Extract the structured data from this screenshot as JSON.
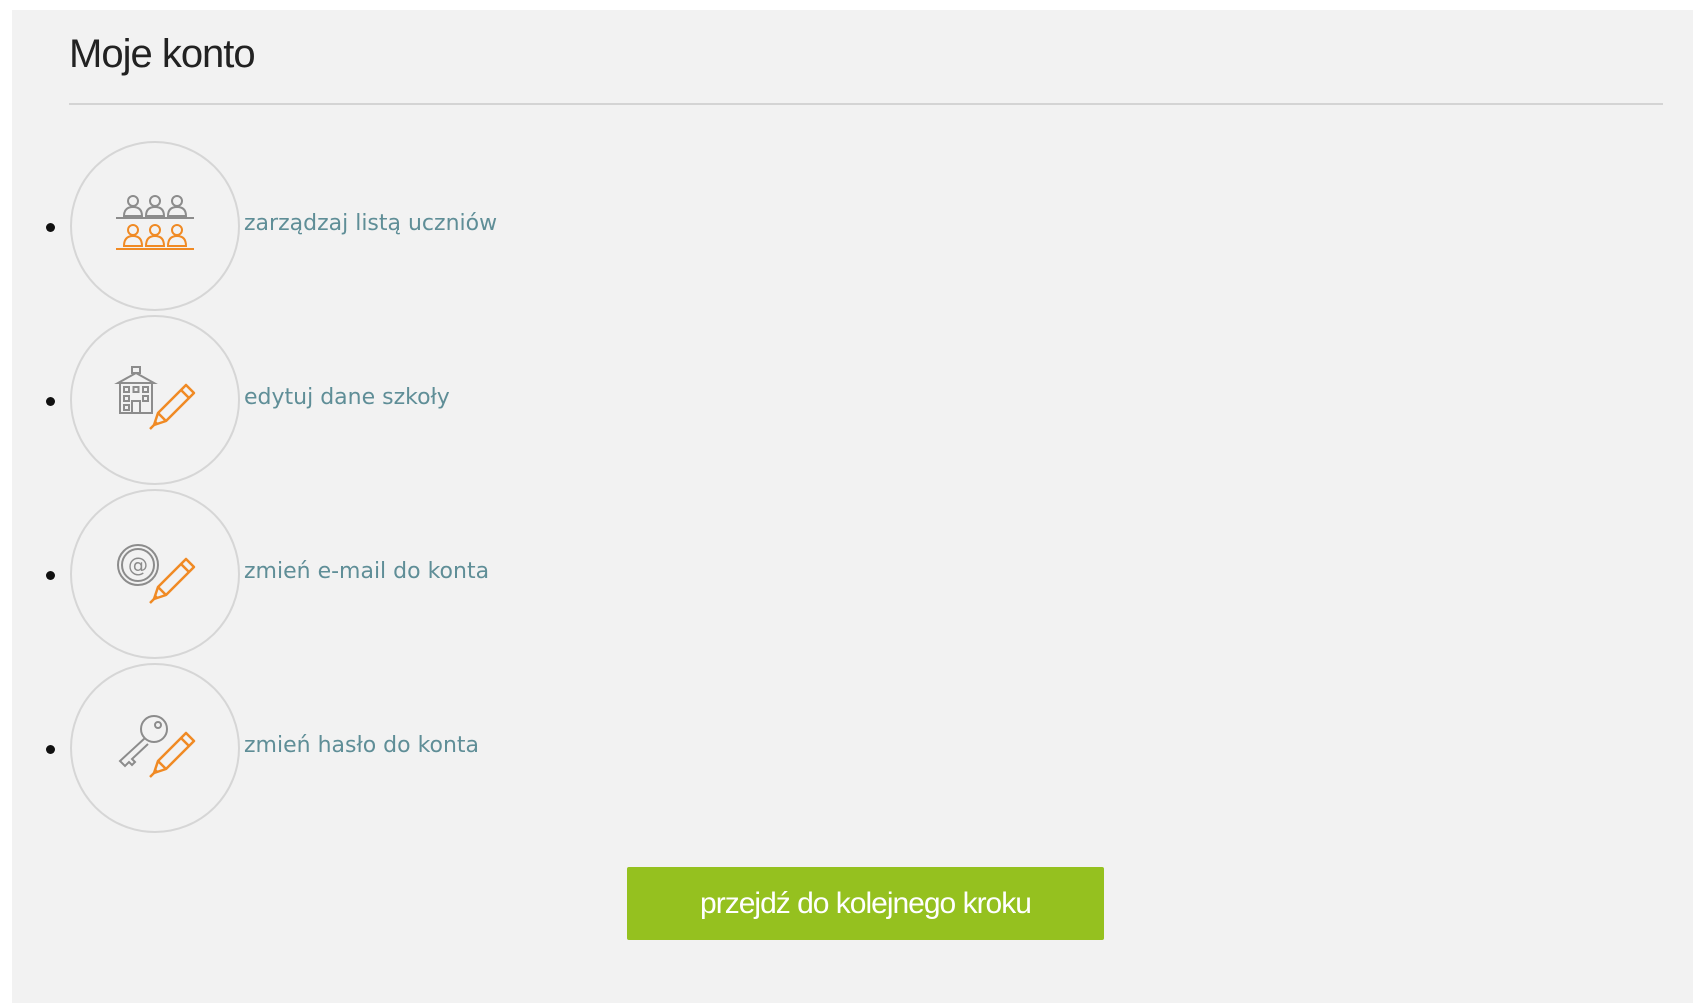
{
  "page": {
    "title": "Moje konto"
  },
  "menu": {
    "items": [
      {
        "label": "zarządzaj listą uczniów",
        "icon": "students-icon"
      },
      {
        "label": "edytuj dane szkoły",
        "icon": "school-edit-icon"
      },
      {
        "label": "zmień e-mail do konta",
        "icon": "email-edit-icon"
      },
      {
        "label": "zmień hasło do konta",
        "icon": "password-edit-icon"
      }
    ]
  },
  "actions": {
    "next_label": "przejdź do kolejnego kroku"
  },
  "colors": {
    "panel_background": "#f2f2f2",
    "link": "#5f8e97",
    "icon_accent": "#f08a24",
    "icon_gray": "#8c8c8c",
    "button": "#95c11f",
    "button_text": "#ffffff"
  }
}
